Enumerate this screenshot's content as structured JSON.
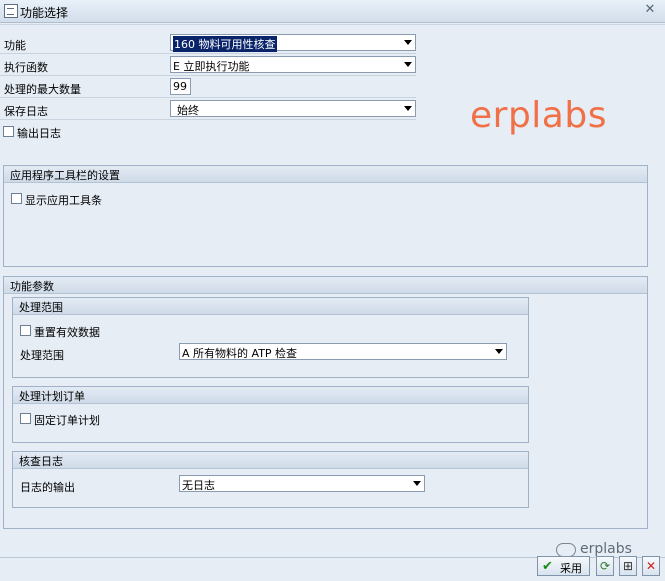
{
  "window": {
    "title": "功能选择"
  },
  "form": {
    "rows": [
      {
        "label": "功能",
        "value": "160 物料可用性核查"
      },
      {
        "label": "执行函数",
        "value": "E 立即执行功能"
      },
      {
        "label": "处理的最大数量",
        "value": "99"
      },
      {
        "label": "保存日志",
        "value": "始终"
      }
    ],
    "output_log": "输出日志"
  },
  "watermark": "erplabs",
  "toolbar_group": {
    "title": "应用程序工具栏的设置",
    "show_toolbar": "显示应用工具条"
  },
  "params": {
    "title": "功能参数",
    "scope": {
      "title": "处理范围",
      "reset": "重置有效数据",
      "label": "处理范围",
      "value": "A 所有物料的 ATP 检查"
    },
    "planned_orders": {
      "title": "处理计划订单",
      "firm": "固定订单计划"
    },
    "check_log": {
      "title": "核查日志",
      "label": "日志的输出",
      "value": "无日志"
    }
  },
  "footer": {
    "watermark": "erplabs",
    "accept_label": "采用"
  },
  "colors": {
    "accept_check": "#1b8a1b",
    "cancel_x": "#cc1f1f",
    "watermark": "#f07048"
  }
}
